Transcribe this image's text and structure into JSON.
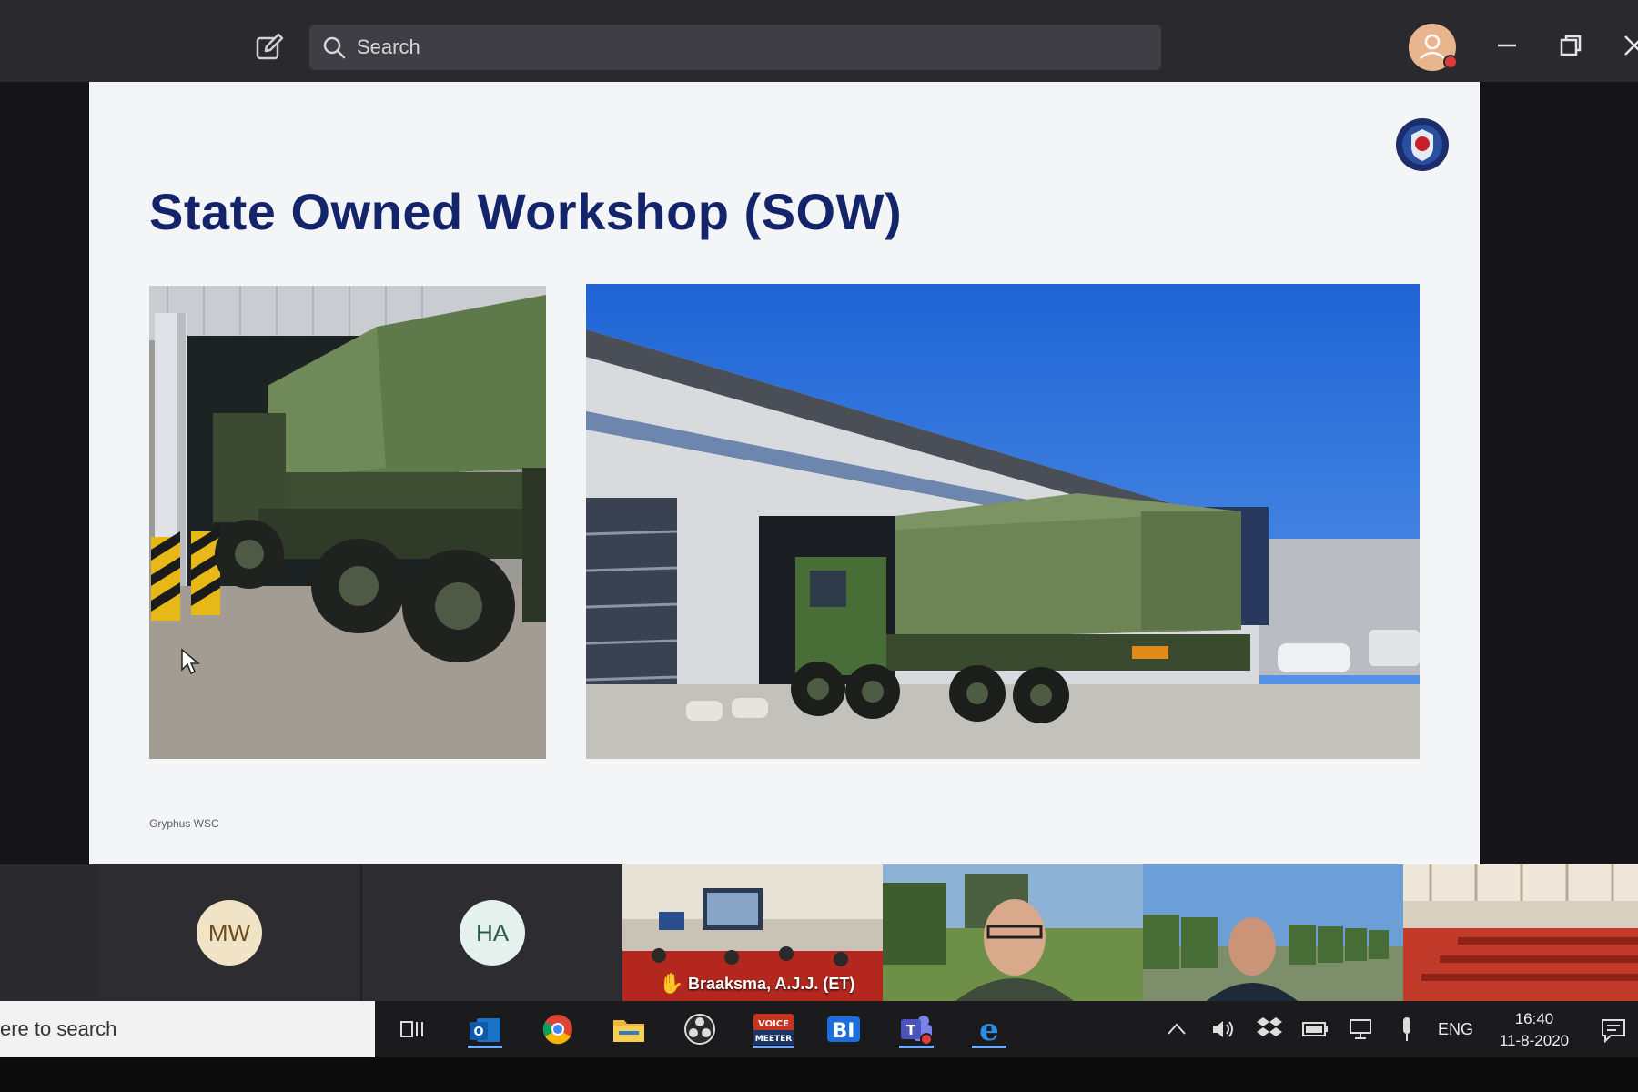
{
  "topbar": {
    "search_placeholder": "Search",
    "icons": [
      "compose-icon",
      "search-icon",
      "avatar",
      "minimize-icon",
      "restore-icon",
      "close-icon"
    ]
  },
  "slide": {
    "title": "State Owned Workshop (SOW)",
    "footer": "Gryphus WSC",
    "colors": {
      "title": "#13246b",
      "background": "#f4f5f7"
    }
  },
  "participants": [
    {
      "initials": "MW",
      "type": "avatar",
      "color": "#f1e3c6",
      "text_color": "#6b4e1f"
    },
    {
      "initials": "HA",
      "type": "avatar",
      "color": "#e4f1ec",
      "text_color": "#2e5b4a"
    },
    {
      "name": "Braaksma, A.J.J. (ET)",
      "type": "video",
      "hand_raised": true
    },
    {
      "type": "video"
    },
    {
      "type": "video"
    },
    {
      "type": "video"
    }
  ],
  "taskbar": {
    "search_text": "ere to search",
    "apps": [
      "task-view-icon",
      "outlook-icon",
      "chrome-icon",
      "file-explorer-icon",
      "obs-icon",
      "voicemeeter-icon",
      "bluejeans-icon",
      "teams-icon",
      "edge-icon"
    ],
    "voicemeeter_label_1": "VOICE",
    "voicemeeter_label_2": "MEETER",
    "bi_label": "BI",
    "tray": {
      "language": "ENG",
      "time": "16:40",
      "date": "11-8-2020"
    }
  }
}
